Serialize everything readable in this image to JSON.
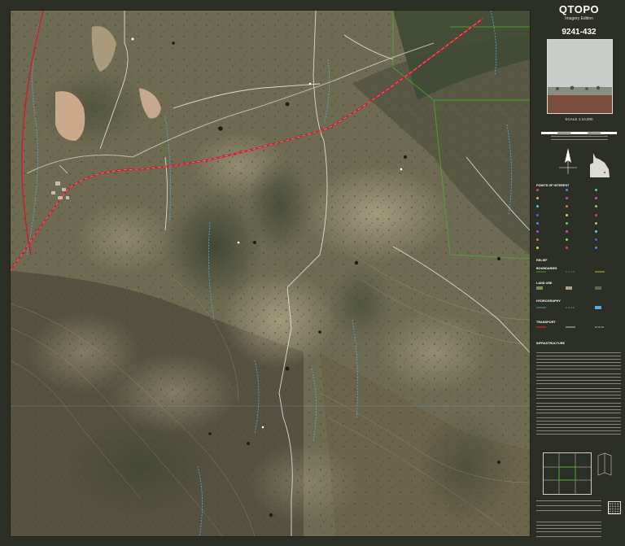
{
  "panel": {
    "brand": "QTOPO",
    "edition": "Imagery Edition",
    "sheet_number": "9241-432",
    "scale_text": "SCALE 1:10,000",
    "headings": {
      "points_of_interest": "POINTS OF INTEREST",
      "relief": "RELIEF",
      "boundaries": "BOUNDARIES",
      "land_use": "LAND USE",
      "hydrography": "HYDROGRAPHY",
      "transport": "TRANSPORT",
      "infrastructure": "INFRASTRUCTURE"
    }
  },
  "colors": {
    "highway": "#c0262d",
    "road_white": "#e8e8e4",
    "boundary_green": "#4caf2e",
    "watercourse": "#5fa8d8",
    "contour": "#c8b48a",
    "panel_bg": "#2b2f26"
  },
  "icons": [
    "camera-icon",
    "qr-code-icon",
    "queensland-locator-icon",
    "north-arrow-icon"
  ]
}
